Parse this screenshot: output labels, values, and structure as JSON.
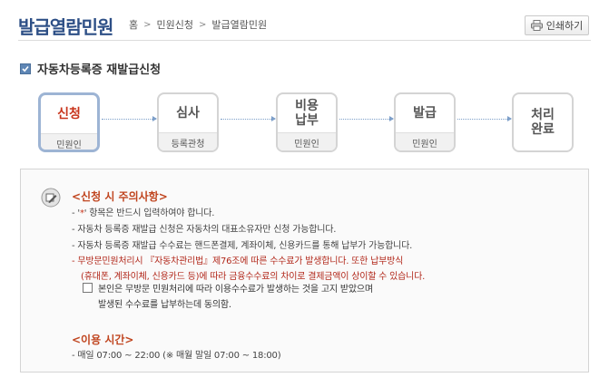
{
  "header": {
    "title": "발급열람민원",
    "breadcrumb": [
      "홈",
      "민원신청",
      "발급열람민원"
    ],
    "breadcrumb_sep": ">",
    "print_label": "인쇄하기"
  },
  "section": {
    "title": "자동차등록증 재발급신청"
  },
  "steps": [
    {
      "name": "신청",
      "sub": "민원인",
      "active": true
    },
    {
      "name": "심사",
      "sub": "등록관청"
    },
    {
      "name": "비용\n납부",
      "sub": "민원인"
    },
    {
      "name": "발급",
      "sub": "민원인"
    },
    {
      "name": "처리\n완료",
      "sub": ""
    }
  ],
  "notice": {
    "caution_title": "<신청 시 주의사항>",
    "required_prefix": "- '",
    "required_star": "*",
    "required_suffix": "' 항목은 반드시 입력하여야 합니다.",
    "lines": [
      "- 자동차 등록증 재발급 신청은 자동차의 대표소유자만 신청 가능합니다.",
      "- 자동차 등록증 재발급 수수료는 핸드폰결제, 계좌이체, 신용카드를 통해 납부가 가능합니다."
    ],
    "red_lines": [
      "- 무방문민원처리시 『자동차관리법』제76조에 따른 수수료가 발생합니다. 또한 납부방식",
      "(휴대폰, 계좌이체, 신용카드 등)에 따라 금융수수료의 차이로 결제금액이 상이할 수 있습니다."
    ],
    "agree_text": "본인은 무방문 민원처리에 따라 이용수수료가 발생하는 것을 고지 받았으며\n발생된 수수료를 납부하는데 동의함.",
    "hours_title": "<이용 시간>",
    "hours_line": "- 매일 07:00 ~ 22:00 (※ 매월 말일 07:00 ~ 18:00)"
  },
  "colors": {
    "title": "#2d4f86",
    "accent_red": "#c8341b",
    "active_border": "#9db4d4",
    "arrow": "#7d9fc9"
  }
}
